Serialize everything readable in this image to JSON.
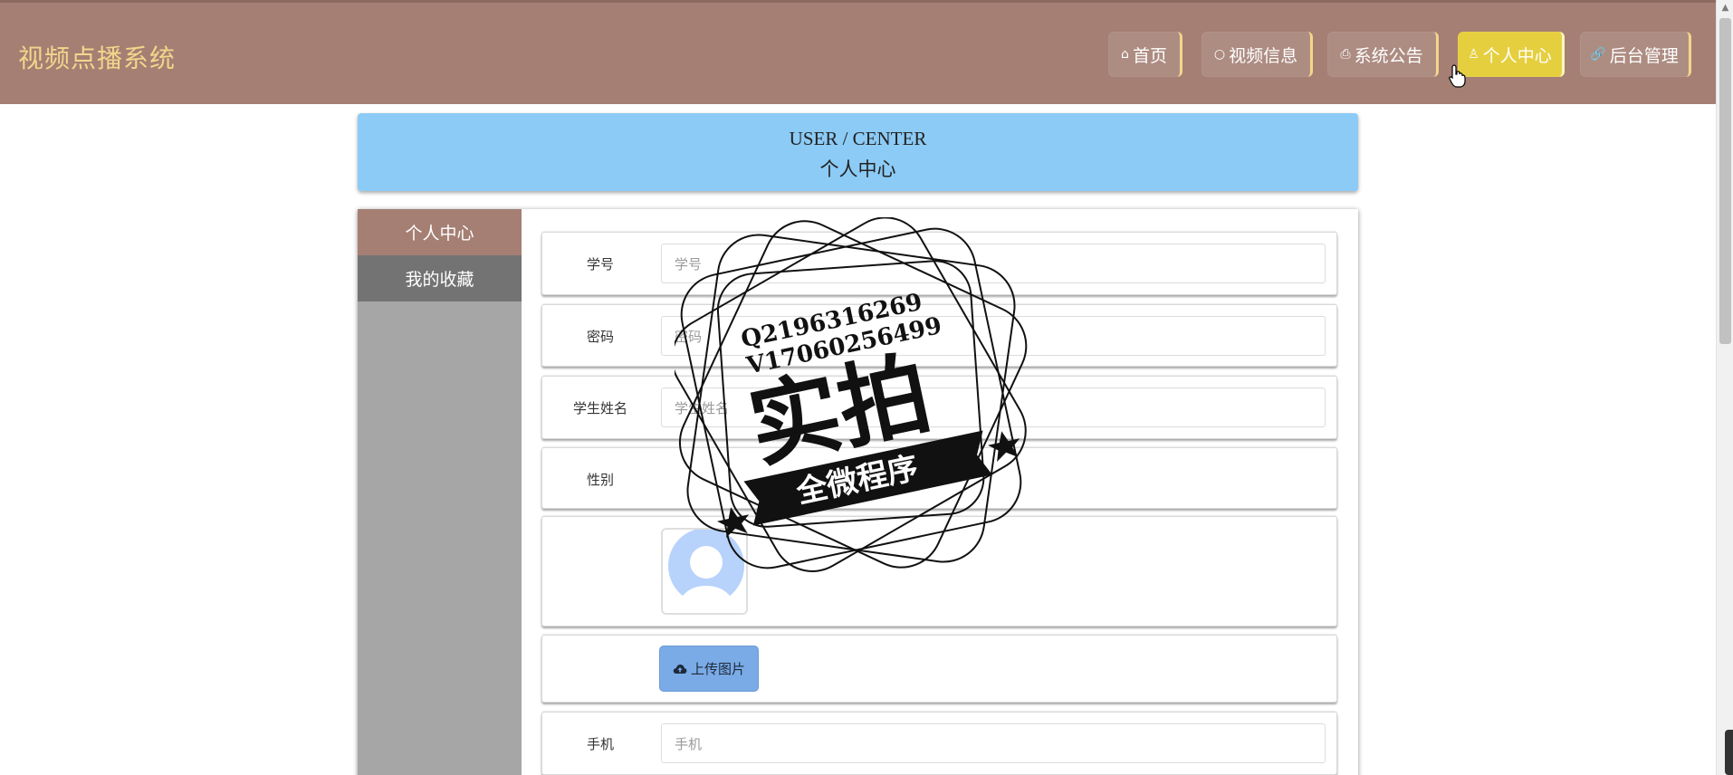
{
  "brand": {
    "title": "视频点播系统"
  },
  "nav": [
    {
      "icon": "home-icon",
      "glyph": "⌂",
      "label": "首页"
    },
    {
      "icon": "circle-icon",
      "glyph": "○",
      "label": "视频信息"
    },
    {
      "icon": "printer-icon",
      "glyph": "⎙",
      "label": "系统公告"
    },
    {
      "icon": "user-icon",
      "glyph": "♙",
      "label": "个人中心",
      "active": true
    },
    {
      "icon": "link-icon",
      "glyph": "🔗",
      "label": "后台管理"
    }
  ],
  "banner": {
    "title_en": "USER / CENTER",
    "title_cn": "个人中心"
  },
  "sidebar": {
    "items": [
      {
        "label": "个人中心",
        "active": true
      },
      {
        "label": "我的收藏",
        "active": false
      }
    ]
  },
  "form": {
    "student_id": {
      "label": "学号",
      "placeholder": "学号"
    },
    "password": {
      "label": "密码",
      "placeholder": "密码"
    },
    "student_name": {
      "label": "学生姓名",
      "placeholder": "学生姓名"
    },
    "gender": {
      "label": "性别"
    },
    "upload": {
      "label": "上传图片",
      "icon": "cloud-upload-icon"
    },
    "phone": {
      "label": "手机",
      "placeholder": "手机"
    }
  },
  "watermark": {
    "line1": "Q2196316269",
    "line2": "V17060256499",
    "main": "实拍",
    "ribbon": "全微程序"
  },
  "colors": {
    "topbar": "#a57f73",
    "brand": "#f3d58c",
    "nav_active": "#e6cf3f",
    "banner": "#8ccbf5",
    "sidebar": "#a6a6a6",
    "upload_button": "#7aabe6"
  }
}
